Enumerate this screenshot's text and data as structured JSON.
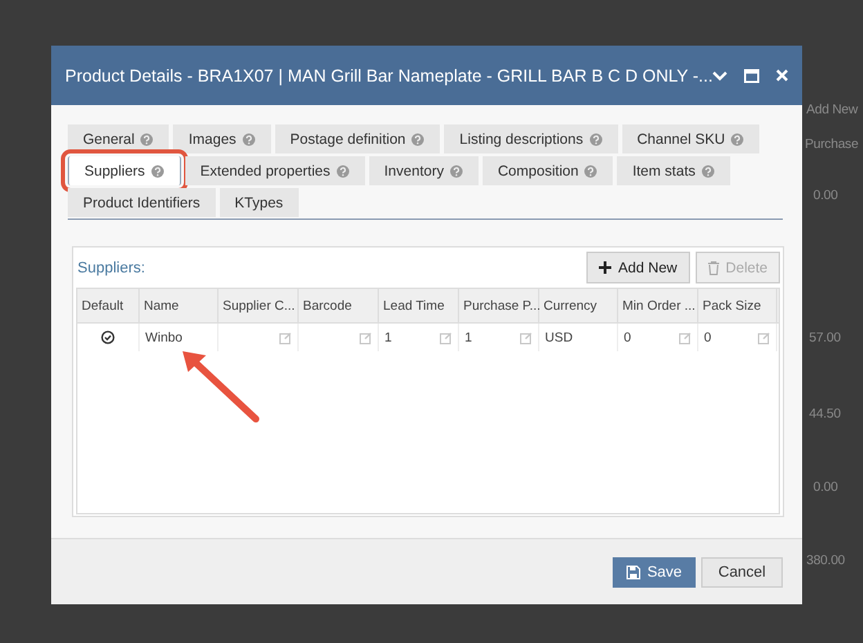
{
  "background": {
    "texts": [
      "Add New",
      "Purchase",
      "0.00",
      "57.00",
      "44.50",
      "0.00",
      "380.00"
    ]
  },
  "window": {
    "title": "Product Details - BRA1X07 | MAN Grill Bar Nameplate - GRILL BAR B C D ONLY -..."
  },
  "tab_rows": [
    [
      {
        "label": "General",
        "help": true,
        "selected": false
      },
      {
        "label": "Images",
        "help": true,
        "selected": false
      },
      {
        "label": "Postage definition",
        "help": true,
        "selected": false
      },
      {
        "label": "Listing descriptions",
        "help": true,
        "selected": false
      },
      {
        "label": "Channel SKU",
        "help": true,
        "selected": false
      }
    ],
    [
      {
        "label": "Suppliers",
        "help": true,
        "selected": true,
        "highlighted": true
      },
      {
        "label": "Extended properties",
        "help": true,
        "selected": false
      },
      {
        "label": "Inventory",
        "help": true,
        "selected": false
      },
      {
        "label": "Composition",
        "help": true,
        "selected": false
      },
      {
        "label": "Item stats",
        "help": true,
        "selected": false
      }
    ],
    [
      {
        "label": "Product Identifiers",
        "help": false,
        "selected": false
      },
      {
        "label": "KTypes",
        "help": false,
        "selected": false
      }
    ]
  ],
  "suppliers": {
    "title": "Suppliers:",
    "add_button": "Add New",
    "delete_button": {
      "label": "Delete",
      "disabled": true
    },
    "table": {
      "columns": [
        {
          "label": "Default",
          "editable": false
        },
        {
          "label": "Name",
          "editable": false
        },
        {
          "label": "Supplier C...",
          "editable": true
        },
        {
          "label": "Barcode",
          "editable": true
        },
        {
          "label": "Lead Time",
          "editable": true
        },
        {
          "label": "Purchase P...",
          "editable": true
        },
        {
          "label": "Currency",
          "editable": false
        },
        {
          "label": "Min Order ...",
          "editable": true
        },
        {
          "label": "Pack Size",
          "editable": true
        }
      ],
      "rows": [
        {
          "default": true,
          "cells": [
            "",
            "Winbo",
            "",
            "",
            "1",
            "1",
            "USD",
            "0",
            "0"
          ]
        }
      ]
    }
  },
  "buttons": {
    "save": "Save",
    "cancel": "Cancel"
  }
}
